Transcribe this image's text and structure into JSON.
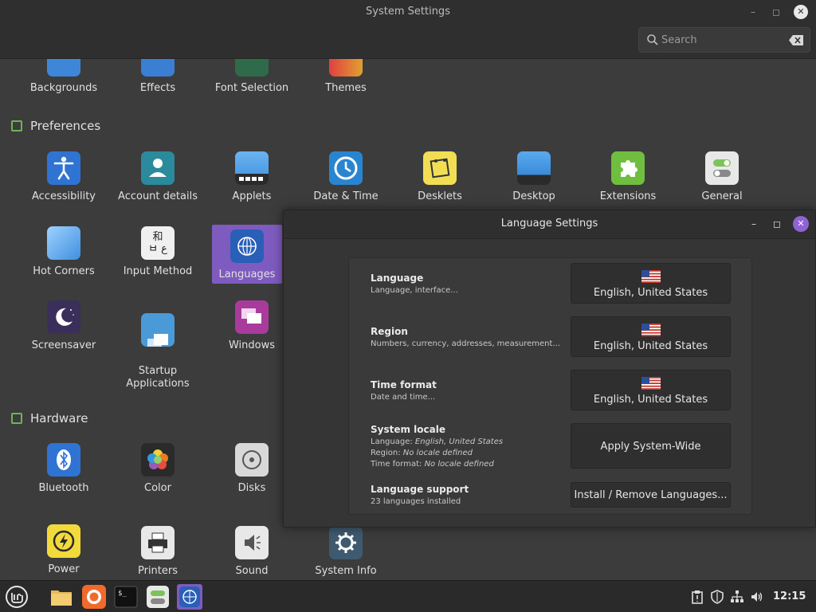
{
  "window": {
    "title": "System Settings"
  },
  "search": {
    "placeholder": "Search"
  },
  "top_row": [
    "Backgrounds",
    "Effects",
    "Font Selection",
    "Themes"
  ],
  "sections": {
    "preferences": "Preferences",
    "hardware": "Hardware"
  },
  "preferences": [
    "Accessibility",
    "Account details",
    "Applets",
    "Date & Time",
    "Desklets",
    "Desktop",
    "Extensions",
    "General",
    "Hot Corners",
    "Input Method",
    "Languages",
    "Screensaver",
    "Startup\nApplications",
    "Windows"
  ],
  "hardware": [
    "Bluetooth",
    "Color",
    "Disks",
    "Power",
    "Printers",
    "Sound",
    "System Info"
  ],
  "dialog": {
    "title": "Language Settings",
    "language": {
      "heading": "Language",
      "sub": "Language, interface...",
      "value": "English, United States"
    },
    "region": {
      "heading": "Region",
      "sub": "Numbers, currency, addresses, measurement...",
      "value": "English, United States"
    },
    "time_format": {
      "heading": "Time format",
      "sub": "Date and time...",
      "value": "English, United States"
    },
    "system_locale": {
      "heading": "System locale",
      "language_label": "Language: ",
      "language_value": "English, United States",
      "region_label": "Region: ",
      "region_value": "No locale defined",
      "time_label": "Time format: ",
      "time_value": "No locale defined",
      "button": "Apply System-Wide"
    },
    "language_support": {
      "heading": "Language support",
      "sub": "23 languages installed",
      "button": "Install / Remove Languages..."
    }
  },
  "taskbar": {
    "clock": "12:15"
  }
}
